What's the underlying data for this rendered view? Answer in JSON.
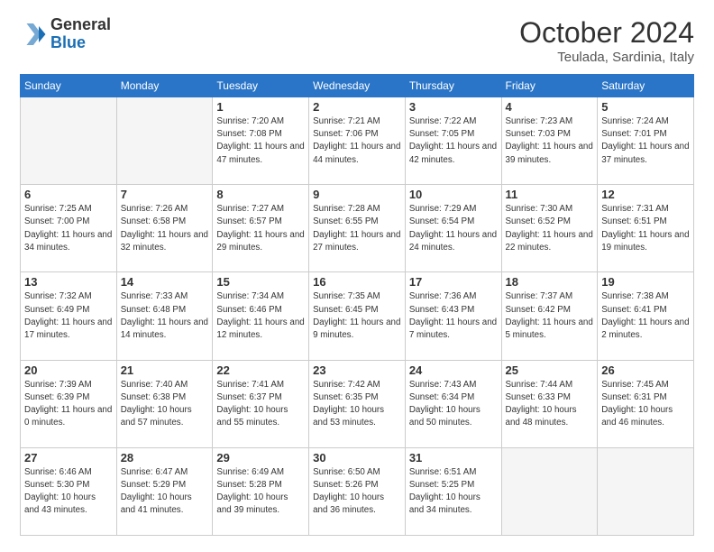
{
  "header": {
    "logo_general": "General",
    "logo_blue": "Blue",
    "main_title": "October 2024",
    "subtitle": "Teulada, Sardinia, Italy"
  },
  "weekdays": [
    "Sunday",
    "Monday",
    "Tuesday",
    "Wednesday",
    "Thursday",
    "Friday",
    "Saturday"
  ],
  "weeks": [
    [
      {
        "day": "",
        "empty": true
      },
      {
        "day": "",
        "empty": true
      },
      {
        "day": "1",
        "sunrise": "7:20 AM",
        "sunset": "7:08 PM",
        "daylight": "11 hours and 47 minutes."
      },
      {
        "day": "2",
        "sunrise": "7:21 AM",
        "sunset": "7:06 PM",
        "daylight": "11 hours and 44 minutes."
      },
      {
        "day": "3",
        "sunrise": "7:22 AM",
        "sunset": "7:05 PM",
        "daylight": "11 hours and 42 minutes."
      },
      {
        "day": "4",
        "sunrise": "7:23 AM",
        "sunset": "7:03 PM",
        "daylight": "11 hours and 39 minutes."
      },
      {
        "day": "5",
        "sunrise": "7:24 AM",
        "sunset": "7:01 PM",
        "daylight": "11 hours and 37 minutes."
      }
    ],
    [
      {
        "day": "6",
        "sunrise": "7:25 AM",
        "sunset": "7:00 PM",
        "daylight": "11 hours and 34 minutes."
      },
      {
        "day": "7",
        "sunrise": "7:26 AM",
        "sunset": "6:58 PM",
        "daylight": "11 hours and 32 minutes."
      },
      {
        "day": "8",
        "sunrise": "7:27 AM",
        "sunset": "6:57 PM",
        "daylight": "11 hours and 29 minutes."
      },
      {
        "day": "9",
        "sunrise": "7:28 AM",
        "sunset": "6:55 PM",
        "daylight": "11 hours and 27 minutes."
      },
      {
        "day": "10",
        "sunrise": "7:29 AM",
        "sunset": "6:54 PM",
        "daylight": "11 hours and 24 minutes."
      },
      {
        "day": "11",
        "sunrise": "7:30 AM",
        "sunset": "6:52 PM",
        "daylight": "11 hours and 22 minutes."
      },
      {
        "day": "12",
        "sunrise": "7:31 AM",
        "sunset": "6:51 PM",
        "daylight": "11 hours and 19 minutes."
      }
    ],
    [
      {
        "day": "13",
        "sunrise": "7:32 AM",
        "sunset": "6:49 PM",
        "daylight": "11 hours and 17 minutes."
      },
      {
        "day": "14",
        "sunrise": "7:33 AM",
        "sunset": "6:48 PM",
        "daylight": "11 hours and 14 minutes."
      },
      {
        "day": "15",
        "sunrise": "7:34 AM",
        "sunset": "6:46 PM",
        "daylight": "11 hours and 12 minutes."
      },
      {
        "day": "16",
        "sunrise": "7:35 AM",
        "sunset": "6:45 PM",
        "daylight": "11 hours and 9 minutes."
      },
      {
        "day": "17",
        "sunrise": "7:36 AM",
        "sunset": "6:43 PM",
        "daylight": "11 hours and 7 minutes."
      },
      {
        "day": "18",
        "sunrise": "7:37 AM",
        "sunset": "6:42 PM",
        "daylight": "11 hours and 5 minutes."
      },
      {
        "day": "19",
        "sunrise": "7:38 AM",
        "sunset": "6:41 PM",
        "daylight": "11 hours and 2 minutes."
      }
    ],
    [
      {
        "day": "20",
        "sunrise": "7:39 AM",
        "sunset": "6:39 PM",
        "daylight": "11 hours and 0 minutes."
      },
      {
        "day": "21",
        "sunrise": "7:40 AM",
        "sunset": "6:38 PM",
        "daylight": "10 hours and 57 minutes."
      },
      {
        "day": "22",
        "sunrise": "7:41 AM",
        "sunset": "6:37 PM",
        "daylight": "10 hours and 55 minutes."
      },
      {
        "day": "23",
        "sunrise": "7:42 AM",
        "sunset": "6:35 PM",
        "daylight": "10 hours and 53 minutes."
      },
      {
        "day": "24",
        "sunrise": "7:43 AM",
        "sunset": "6:34 PM",
        "daylight": "10 hours and 50 minutes."
      },
      {
        "day": "25",
        "sunrise": "7:44 AM",
        "sunset": "6:33 PM",
        "daylight": "10 hours and 48 minutes."
      },
      {
        "day": "26",
        "sunrise": "7:45 AM",
        "sunset": "6:31 PM",
        "daylight": "10 hours and 46 minutes."
      }
    ],
    [
      {
        "day": "27",
        "sunrise": "6:46 AM",
        "sunset": "5:30 PM",
        "daylight": "10 hours and 43 minutes."
      },
      {
        "day": "28",
        "sunrise": "6:47 AM",
        "sunset": "5:29 PM",
        "daylight": "10 hours and 41 minutes."
      },
      {
        "day": "29",
        "sunrise": "6:49 AM",
        "sunset": "5:28 PM",
        "daylight": "10 hours and 39 minutes."
      },
      {
        "day": "30",
        "sunrise": "6:50 AM",
        "sunset": "5:26 PM",
        "daylight": "10 hours and 36 minutes."
      },
      {
        "day": "31",
        "sunrise": "6:51 AM",
        "sunset": "5:25 PM",
        "daylight": "10 hours and 34 minutes."
      },
      {
        "day": "",
        "empty": true
      },
      {
        "day": "",
        "empty": true
      }
    ]
  ]
}
